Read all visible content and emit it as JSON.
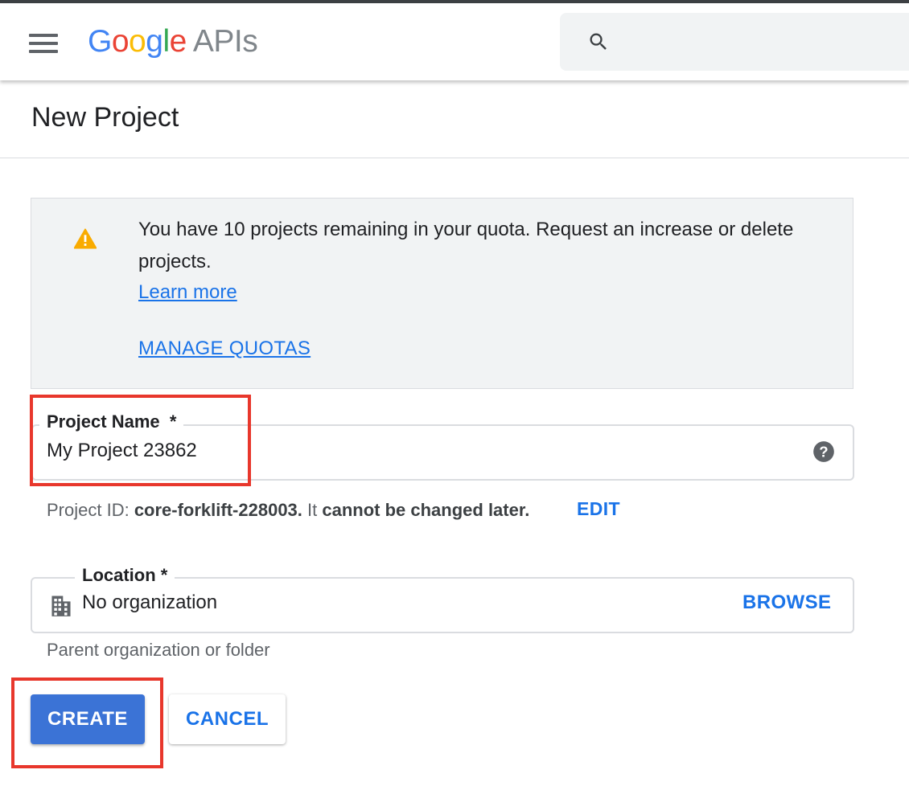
{
  "header": {
    "logo": {
      "letters": [
        "G",
        "o",
        "o",
        "g",
        "l",
        "e"
      ],
      "letter_colors": [
        "#4285f4",
        "#ea4335",
        "#fbbc05",
        "#4285f4",
        "#34a853",
        "#ea4335"
      ],
      "suffix": "APIs"
    },
    "search": {
      "placeholder": "",
      "value": ""
    },
    "icons": {
      "menu": "hamburger-menu-icon",
      "search": "search-icon"
    }
  },
  "page": {
    "title": "New Project"
  },
  "quota_notice": {
    "icon": "warning-icon",
    "icon_color": "#f9ab00",
    "message": "You have 10 projects remaining in your quota. Request an increase or delete projects.",
    "learn_more": "Learn more",
    "manage_quotas": "MANAGE QUOTAS"
  },
  "project_name": {
    "label": "Project Name",
    "required_mark": "*",
    "value": "My Project 23862",
    "help_icon": "help-icon"
  },
  "project_id": {
    "prefix": "Project ID: ",
    "id": "core-forklift-228003.",
    "middle": " It ",
    "suffix": "cannot be changed later.",
    "edit": "EDIT"
  },
  "location": {
    "label": "Location",
    "required_mark": "*",
    "icon": "building-icon",
    "value": "No organization",
    "browse": "BROWSE",
    "helper": "Parent organization or folder"
  },
  "actions": {
    "create": "CREATE",
    "cancel": "CANCEL"
  },
  "colors": {
    "accent": "#1a73e8",
    "primary_button": "#3b73d6",
    "highlight": "#e8372c",
    "notice_bg": "#f1f3f4"
  }
}
